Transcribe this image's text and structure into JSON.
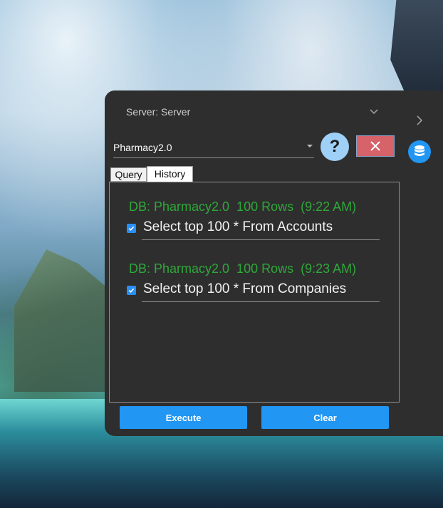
{
  "server": {
    "label": "Server: Server"
  },
  "database": {
    "selected": "Pharmacy2.0"
  },
  "buttons": {
    "help": "?",
    "execute": "Execute",
    "clear": "Clear"
  },
  "tabs": [
    {
      "label": "Query"
    },
    {
      "label": "History"
    }
  ],
  "history": [
    {
      "meta": "DB: Pharmacy2.0  100 Rows  (9:22 AM)",
      "query": "Select top 100 * From Accounts",
      "checked": true
    },
    {
      "meta": "DB: Pharmacy2.0  100 Rows  (9:23 AM)",
      "query": "Select top 100 * From Companies",
      "checked": true
    }
  ],
  "colors": {
    "accent": "#2196f3",
    "close": "#d6626a",
    "history_meta": "#2fa83a",
    "panel": "#2e2e2e"
  },
  "icons": {
    "server_expand": "chevron-down-icon",
    "side_expand": "chevron-right-icon",
    "close": "close-icon",
    "db": "database-icon",
    "check": "checkbox-icon"
  }
}
